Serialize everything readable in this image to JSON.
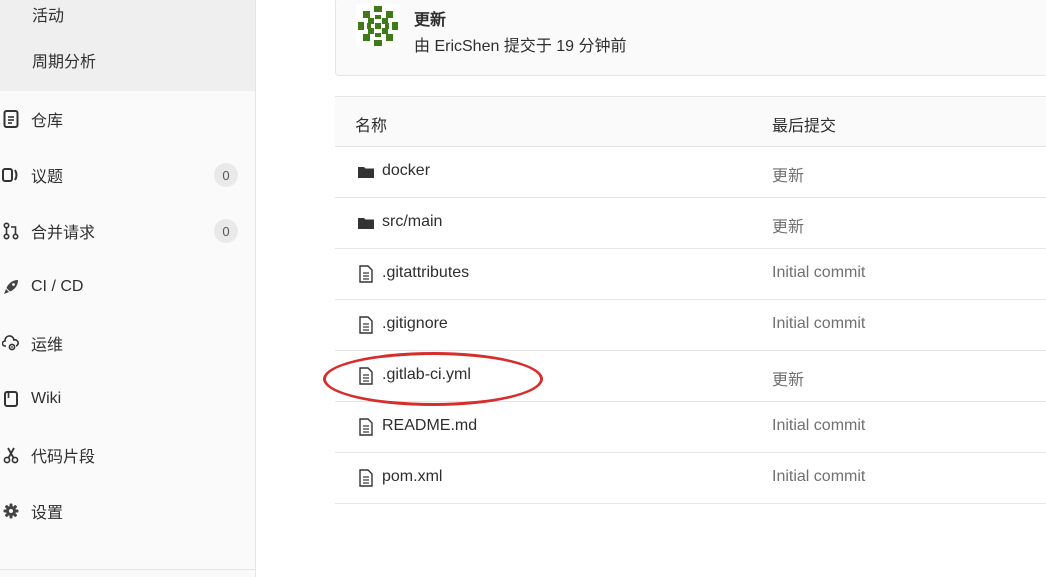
{
  "sidebar": {
    "sub_items": [
      {
        "label": "活动"
      },
      {
        "label": "周期分析"
      }
    ],
    "items": [
      {
        "label": "仓库",
        "icon": "repository-icon"
      },
      {
        "label": "议题",
        "icon": "issues-icon",
        "count": "0"
      },
      {
        "label": "合并请求",
        "icon": "merge-request-icon",
        "count": "0"
      },
      {
        "label": "CI / CD",
        "icon": "rocket-icon"
      },
      {
        "label": "运维",
        "icon": "operations-icon"
      },
      {
        "label": "Wiki",
        "icon": "book-icon"
      },
      {
        "label": "代码片段",
        "icon": "scissors-icon"
      },
      {
        "label": "设置",
        "icon": "gear-icon"
      }
    ]
  },
  "commit": {
    "title": "更新",
    "meta": "由 EricShen 提交于 19 分钟前"
  },
  "table": {
    "headers": {
      "name": "名称",
      "last_commit": "最后提交"
    },
    "rows": [
      {
        "type": "folder",
        "name": "docker",
        "commit": "更新"
      },
      {
        "type": "folder",
        "name": "src/main",
        "commit": "更新"
      },
      {
        "type": "file",
        "name": ".gitattributes",
        "commit": "Initial commit"
      },
      {
        "type": "file",
        "name": ".gitignore",
        "commit": "Initial commit"
      },
      {
        "type": "file",
        "name": ".gitlab-ci.yml",
        "commit": "更新"
      },
      {
        "type": "file",
        "name": "README.md",
        "commit": "Initial commit"
      },
      {
        "type": "file",
        "name": "pom.xml",
        "commit": "Initial commit"
      }
    ]
  },
  "colors": {
    "highlight": "#d62d2d",
    "avatar": "#3e7a17"
  }
}
